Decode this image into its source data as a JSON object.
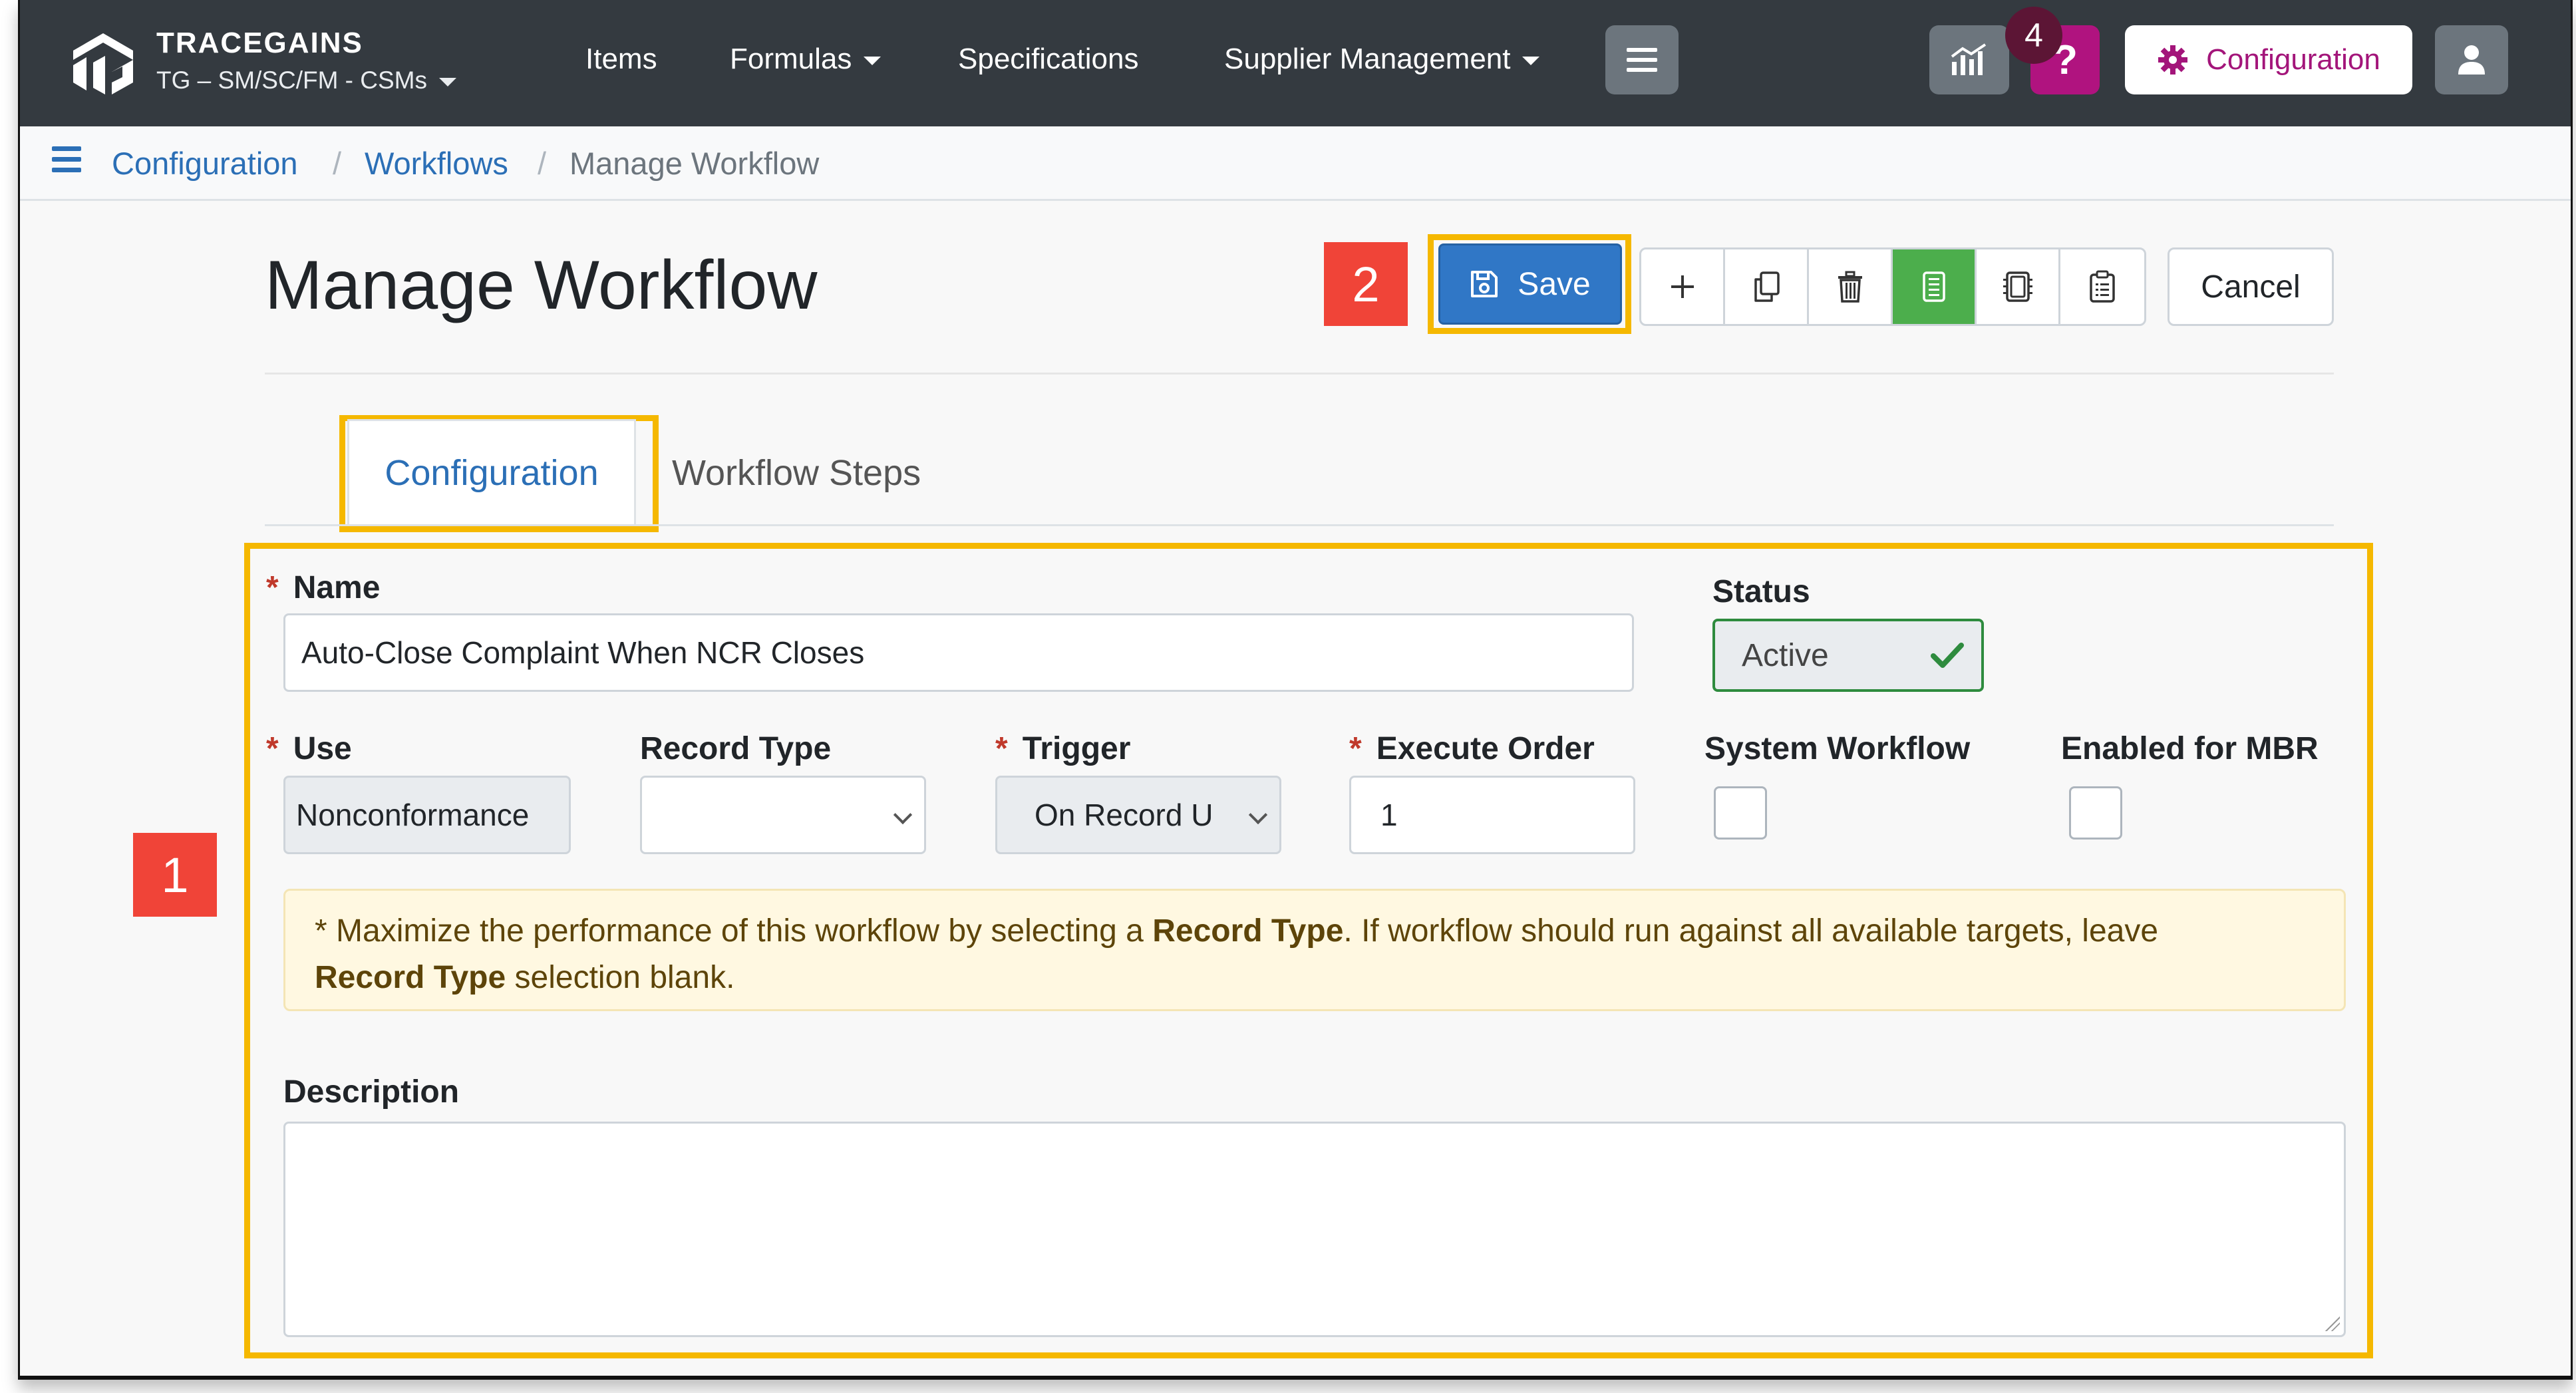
{
  "navbar": {
    "brand_title": "TRACEGAINS",
    "brand_sub": "TG – SM/SC/FM - CSMs",
    "links": {
      "items": "Items",
      "formulas": "Formulas",
      "specifications": "Specifications",
      "supplier_management": "Supplier Management"
    },
    "help_label": "?",
    "configuration_label": "Configuration",
    "brand_color": "#a3157a"
  },
  "breadcrumb": {
    "configuration": "Configuration",
    "workflows": "Workflows",
    "current": "Manage Workflow",
    "separator": "/"
  },
  "page": {
    "title": "Manage Workflow",
    "save_label": "Save",
    "cancel_label": "Cancel"
  },
  "tabs": {
    "configuration": "Configuration",
    "workflow_steps": "Workflow Steps"
  },
  "form": {
    "name_label": "Name",
    "name_value": "Auto-Close Complaint When NCR Closes",
    "status_label": "Status",
    "status_value": "Active",
    "use_label": "Use",
    "use_value": "Nonconformance",
    "record_type_label": "Record Type",
    "record_type_value": "",
    "trigger_label": "Trigger",
    "trigger_value": "On Record U",
    "execute_order_label": "Execute Order",
    "execute_order_value": "1",
    "system_workflow_label": "System Workflow",
    "enabled_mbr_label": "Enabled for MBR",
    "required_mark": "*",
    "alert": {
      "mark": "*",
      "part1": "Maximize the performance of this workflow by selecting a",
      "bold1": "Record Type",
      "part2": ". If workflow should run against all available targets, leave",
      "bold2": "Record Type",
      "part3": "selection blank."
    },
    "description_label": "Description",
    "description_value": ""
  },
  "annotations": {
    "callout_1": "1",
    "callout_2": "2",
    "callout_4": "4",
    "highlight_color": "#f5b800"
  }
}
